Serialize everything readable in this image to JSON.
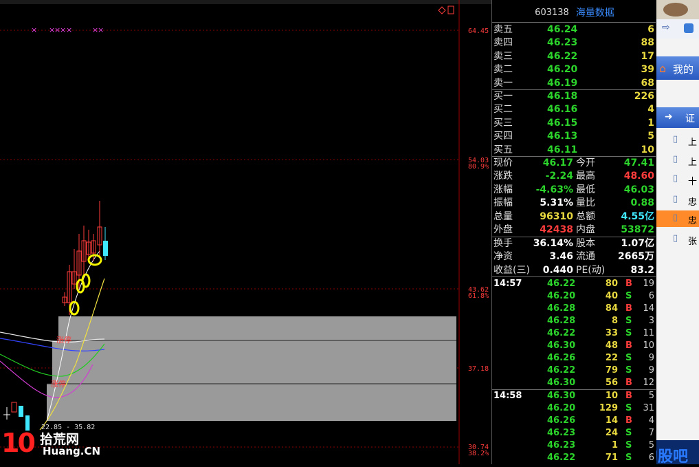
{
  "chart": {
    "price_labels": [
      "64.45",
      "54.03",
      "80.9%",
      "43.62",
      "61.8%",
      "37.18",
      "30.74",
      "38.2%"
    ],
    "range_label": "22.85 - 35.82",
    "zone_labels": [
      "涨停",
      "涨停"
    ],
    "top_icon": "diamond-icon"
  },
  "stock": {
    "code": "603138",
    "name": "海量数据"
  },
  "asks": [
    {
      "label": "卖五",
      "price": "46.24",
      "vol": "6"
    },
    {
      "label": "卖四",
      "price": "46.23",
      "vol": "88"
    },
    {
      "label": "卖三",
      "price": "46.22",
      "vol": "17"
    },
    {
      "label": "卖二",
      "price": "46.20",
      "vol": "39"
    },
    {
      "label": "卖一",
      "price": "46.19",
      "vol": "68"
    }
  ],
  "bids": [
    {
      "label": "买一",
      "price": "46.18",
      "vol": "226"
    },
    {
      "label": "买二",
      "price": "46.16",
      "vol": "4"
    },
    {
      "label": "买三",
      "price": "46.15",
      "vol": "1"
    },
    {
      "label": "买四",
      "price": "46.13",
      "vol": "5"
    },
    {
      "label": "买五",
      "price": "46.11",
      "vol": "10"
    }
  ],
  "stats": [
    {
      "l1": "现价",
      "v1": "46.17",
      "l2": "今开",
      "v2": "47.41"
    },
    {
      "l1": "涨跌",
      "v1": "-2.24",
      "l2": "最高",
      "v2": "48.60"
    },
    {
      "l1": "涨幅",
      "v1": "-4.63%",
      "l2": "最低",
      "v2": "46.03"
    },
    {
      "l1": "振幅",
      "v1": "5.31%",
      "l2": "量比",
      "v2": "0.88"
    },
    {
      "l1": "总量",
      "v1": "96310",
      "l2": "总额",
      "v2": "4.55亿"
    },
    {
      "l1": "外盘",
      "v1": "42438",
      "l2": "内盘",
      "v2": "53872"
    }
  ],
  "stats2": [
    {
      "l1": "换手",
      "v1": "36.14%",
      "l2": "股本",
      "v2": "1.07亿"
    },
    {
      "l1": "净资",
      "v1": "3.46",
      "l2": "流通",
      "v2": "2665万"
    },
    {
      "l1": "收益(三)",
      "v1": "0.440",
      "l2": "PE(动)",
      "v2": "83.2"
    }
  ],
  "ticks1": {
    "time": "14:57",
    "rows": [
      {
        "p": "46.22",
        "v": "80",
        "t": "B",
        "n": "19"
      },
      {
        "p": "46.20",
        "v": "40",
        "t": "S",
        "n": "6"
      },
      {
        "p": "46.28",
        "v": "84",
        "t": "B",
        "n": "14"
      },
      {
        "p": "46.28",
        "v": "8",
        "t": "S",
        "n": "3"
      },
      {
        "p": "46.22",
        "v": "33",
        "t": "S",
        "n": "11"
      },
      {
        "p": "46.30",
        "v": "48",
        "t": "B",
        "n": "10"
      },
      {
        "p": "46.26",
        "v": "22",
        "t": "S",
        "n": "9"
      },
      {
        "p": "46.22",
        "v": "79",
        "t": "S",
        "n": "9"
      },
      {
        "p": "46.30",
        "v": "56",
        "t": "B",
        "n": "12"
      }
    ]
  },
  "ticks2": {
    "time": "14:58",
    "rows": [
      {
        "p": "46.30",
        "v": "10",
        "t": "B",
        "n": "5"
      },
      {
        "p": "46.20",
        "v": "129",
        "t": "S",
        "n": "31"
      },
      {
        "p": "46.26",
        "v": "14",
        "t": "B",
        "n": "4"
      },
      {
        "p": "46.23",
        "v": "24",
        "t": "S",
        "n": "7"
      },
      {
        "p": "46.23",
        "v": "1",
        "t": "S",
        "n": "5"
      },
      {
        "p": "46.22",
        "v": "71",
        "t": "S",
        "n": "6"
      }
    ]
  },
  "sidebar": {
    "home": "我的",
    "section": "证",
    "items": [
      "上",
      "上",
      "十",
      "忠",
      "忠",
      "张"
    ]
  },
  "watermark": {
    "num": "10",
    "cn": "拾荒网",
    "en": "Huang.CN",
    "brand": "淘股吧"
  }
}
